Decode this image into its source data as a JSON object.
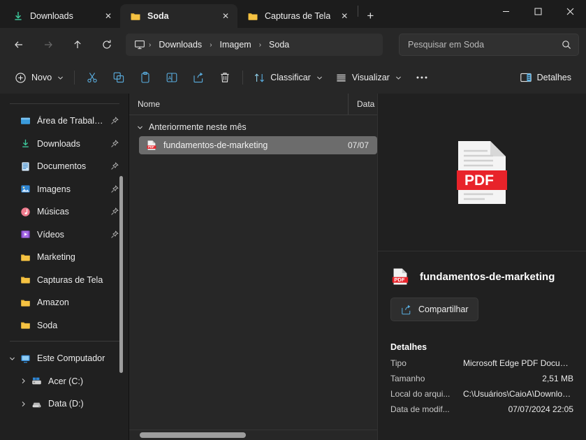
{
  "window": {
    "controls": {
      "minimize": "–",
      "maximize": "□",
      "close": "✕"
    }
  },
  "tabs": {
    "items": [
      {
        "label": "Downloads",
        "icon": "download-icon",
        "active": false,
        "close": "✕"
      },
      {
        "label": "Soda",
        "icon": "folder-icon",
        "active": true,
        "close": "✕"
      },
      {
        "label": "Capturas de Tela",
        "icon": "folder-icon",
        "active": false,
        "close": "✕"
      }
    ],
    "new_tab_label": "+"
  },
  "address": {
    "back": "←",
    "forward": "→",
    "up": "↑",
    "refresh": "↻",
    "crumbs": [
      "Downloads",
      "Imagem",
      "Soda"
    ],
    "separator": "›",
    "home_icon": "monitor-icon"
  },
  "search": {
    "placeholder": "Pesquisar em Soda",
    "value": "",
    "icon": "search-icon"
  },
  "toolbar": {
    "new_label": "Novo",
    "new_chevron": "⌄",
    "cut_label": "Recortar",
    "copy_label": "Copiar",
    "paste_label": "Colar",
    "rename_label": "Renomear",
    "share_label": "Compartilhar",
    "delete_label": "Excluir",
    "sort_label": "Classificar",
    "view_label": "Visualizar",
    "more_label": "•••",
    "details_label": "Detalhes",
    "chevron": "⌄"
  },
  "sidebar": {
    "quick_access": [
      {
        "label": "Área de Trabalho",
        "icon": "desktop-icon",
        "pinned": true
      },
      {
        "label": "Downloads",
        "icon": "download-icon",
        "pinned": true
      },
      {
        "label": "Documentos",
        "icon": "documents-icon",
        "pinned": true
      },
      {
        "label": "Imagens",
        "icon": "pictures-icon",
        "pinned": true
      },
      {
        "label": "Músicas",
        "icon": "music-icon",
        "pinned": true
      },
      {
        "label": "Vídeos",
        "icon": "videos-icon",
        "pinned": true
      },
      {
        "label": "Marketing",
        "icon": "folder-icon",
        "pinned": false
      },
      {
        "label": "Capturas de Tela",
        "icon": "folder-icon",
        "pinned": false
      },
      {
        "label": "Amazon",
        "icon": "folder-icon",
        "pinned": false
      },
      {
        "label": "Soda",
        "icon": "folder-icon",
        "pinned": false
      }
    ],
    "computer": {
      "label": "Este Computador",
      "icon": "computer-icon",
      "expander": "⌄",
      "drives": [
        {
          "label": "Acer (C:)",
          "icon": "windows-drive-icon",
          "expander": "›"
        },
        {
          "label": "Data (D:)",
          "icon": "drive-icon",
          "expander": "›"
        }
      ]
    }
  },
  "filelist": {
    "columns": [
      {
        "label": "Nome",
        "key": "name"
      },
      {
        "label": "Data",
        "key": "date"
      }
    ],
    "groups": [
      {
        "label": "Anteriormente neste mês",
        "chevron": "⌄",
        "rows": [
          {
            "name": "fundamentos-de-marketing",
            "date": "07/07",
            "icon": "pdf-file-icon",
            "selected": true
          }
        ]
      }
    ]
  },
  "details_pane": {
    "preview_icon": "pdf-large-icon",
    "preview_badge": "PDF",
    "file_name": "fundamentos-de-marketing",
    "file_icon": "pdf-file-icon",
    "share_button": "Compartilhar",
    "share_icon": "share-icon",
    "section_title": "Detalhes",
    "properties": [
      {
        "key": "Tipo",
        "value": "Microsoft Edge PDF Document"
      },
      {
        "key": "Tamanho",
        "value": "2,51 MB"
      },
      {
        "key": "Local do arqui...",
        "value": "C:\\Usuários\\CaioA\\Download..."
      },
      {
        "key": "Data de modif...",
        "value": "07/07/2024 22:05"
      }
    ]
  },
  "theme": {
    "background": "#1c1c1c",
    "surface": "#272727",
    "sidebar": "#202020",
    "accent_blue": "#4cc2ff",
    "folder_yellow": "#f5c242",
    "pdf_red": "#e8232a",
    "selection": "#6c6c6c"
  }
}
